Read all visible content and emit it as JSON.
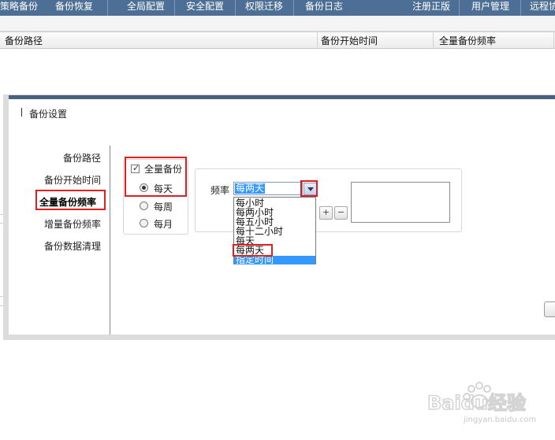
{
  "nav": {
    "left_items": [
      "策略备份",
      "备份恢复",
      "全局配置",
      "安全配置",
      "权限迁移",
      "备份日志"
    ],
    "right_items": [
      "注册正版",
      "用户管理",
      "远程协"
    ],
    "bar_color": "#4e6f95"
  },
  "table": {
    "columns": [
      "备份路径",
      "备份开始时间",
      "全量备份频率"
    ]
  },
  "dialog": {
    "title": "备份设置",
    "left_nav": [
      "备份路径",
      "备份开始时间",
      "全量备份频率",
      "增量备份频率",
      "备份数据清理"
    ],
    "active_left_nav": "全量备份频率",
    "full_backup": {
      "checkbox_label": "全量备份",
      "checked": true,
      "options": [
        "每天",
        "每周",
        "每月"
      ],
      "selected": "每天"
    },
    "frequency": {
      "label": "频率",
      "selected": "每两天",
      "options": [
        "每小时",
        "每两小时",
        "每五小时",
        "每十二小时",
        "每天",
        "每两天",
        "指定时间"
      ],
      "highlighted": "指定时间"
    },
    "add_label": "+",
    "remove_label": "−"
  },
  "watermark": {
    "brand": "Baidu经验",
    "sub": "jingyan.baidu.com"
  },
  "colors": {
    "highlight": "#3399ff",
    "annotation_red": "#e02020",
    "dialog_header": "#4a6282"
  }
}
